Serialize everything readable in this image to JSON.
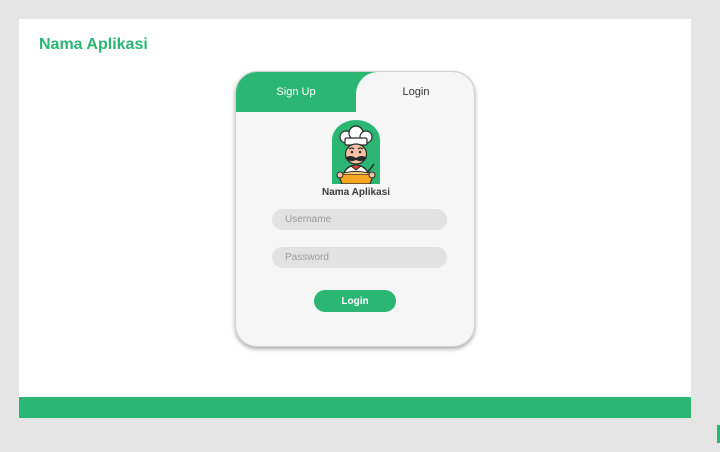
{
  "app": {
    "title": "Nama Aplikasi"
  },
  "tabs": [
    {
      "label": "Sign Up",
      "active": false
    },
    {
      "label": "Login",
      "active": true
    }
  ],
  "card": {
    "brand_name": "Nama Aplikasi",
    "logo_icon": "chef-mascot-icon",
    "username": {
      "value": "",
      "placeholder": "Username"
    },
    "password": {
      "value": "",
      "placeholder": "Password"
    },
    "submit_label": "Login"
  },
  "colors": {
    "accent": "#2bb673",
    "page_background": "#e5e5e5",
    "card_background": "#f6f6f6",
    "input_background": "#e2e2e2"
  }
}
